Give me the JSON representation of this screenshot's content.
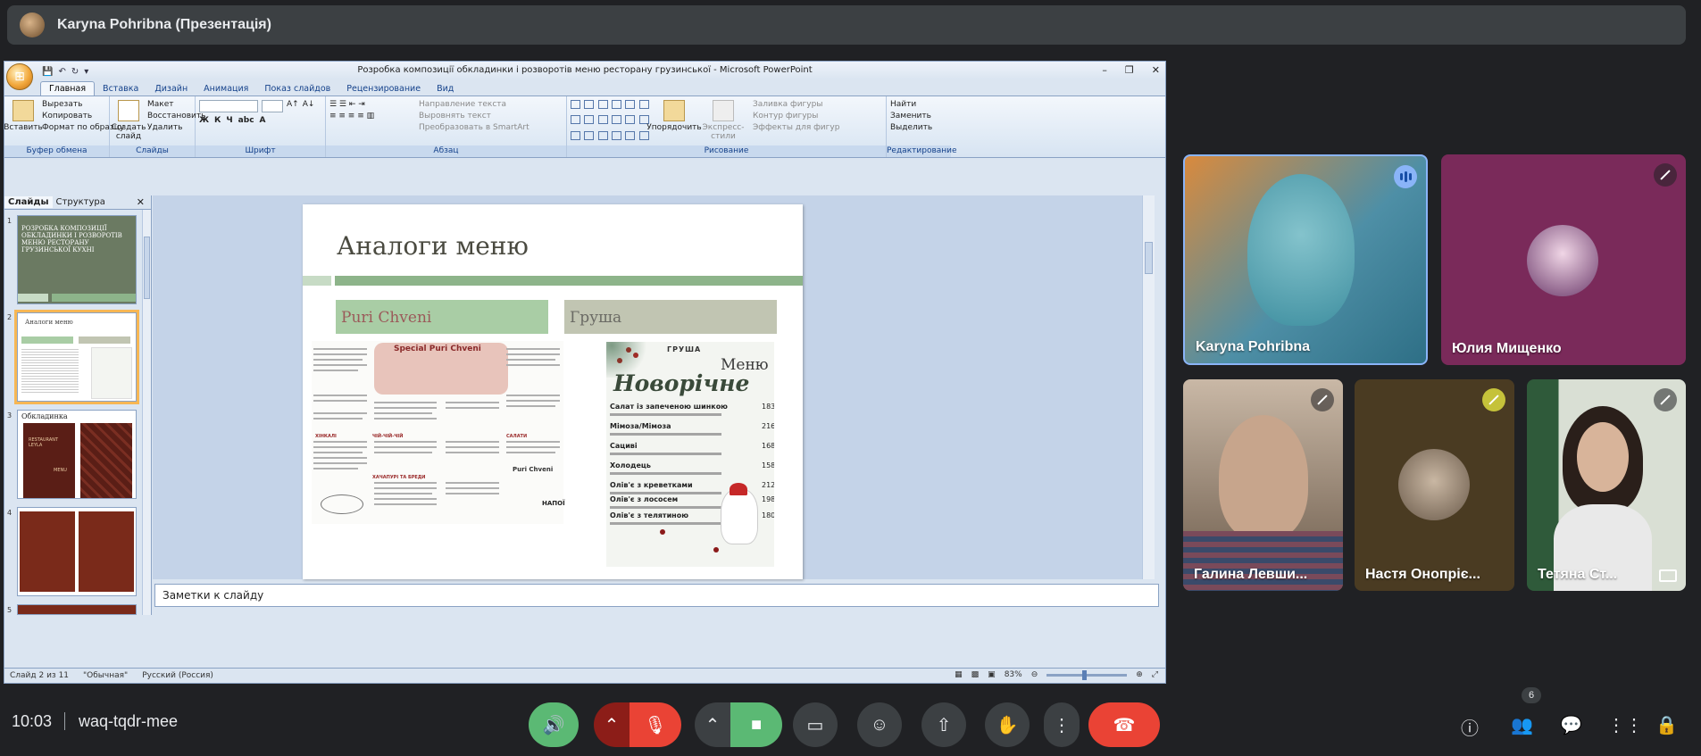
{
  "meet": {
    "presenter_title": "Karyna Pohribna (Презентація)",
    "time": "10:03",
    "meeting_code": "waq-tqdr-mee",
    "participants_count": "6",
    "accent_green": "#5bb974",
    "accent_red": "#ea4335"
  },
  "ppt": {
    "window_title": "Розробка композиції обкладинки і розворотів меню ресторану грузинської - Microsoft PowerPoint",
    "tabs": [
      "Главная",
      "Вставка",
      "Дизайн",
      "Анимация",
      "Показ слайдов",
      "Рецензирование",
      "Вид"
    ],
    "ribbon": {
      "paste_label": "Вставить",
      "cut": "Вырезать",
      "copy": "Копировать",
      "format_painter": "Формат по образцу",
      "clipboard_group": "Буфер обмена",
      "new_slide": "Создать слайд",
      "layout": "Макет",
      "reset": "Восстановить",
      "delete": "Удалить",
      "slides_group": "Слайды",
      "font_group": "Шрифт",
      "text_direction": "Направление текста",
      "align_text": "Выровнять текст",
      "convert_smartart": "Преобразовать в SmartArt",
      "paragraph_group": "Абзац",
      "arrange": "Упорядочить",
      "quick_styles": "Экспресс-стили",
      "shape_fill": "Заливка фигуры",
      "shape_outline": "Контур фигуры",
      "shape_effects": "Эффекты для фигур",
      "drawing_group": "Рисование",
      "find": "Найти",
      "replace": "Заменить",
      "select": "Выделить",
      "editing_group": "Редактирование"
    },
    "panel": {
      "tab_slides": "Слайды",
      "tab_outline": "Структура",
      "close": "✕",
      "slide1_title": "РОЗРОБКА КОМПОЗИЦІЇ ОБКЛАДИНКИ І РОЗВОРОТІВ МЕНЮ РЕСТОРАНУ ГРУЗИНСЬКОЇ КУХНІ",
      "slide2_title": "Аналоги меню",
      "slide3_title": "Обкладинка",
      "slide3_brand": "RESTAURANT LEYLA",
      "slide3_menu": "MENU",
      "nums": [
        "1",
        "2",
        "3",
        "4",
        "5"
      ]
    },
    "slide": {
      "title": "Аналоги меню",
      "label1": "Puri Chveni",
      "label2": "Груша",
      "menu1": {
        "special": "Special Puri Chveni",
        "headers": [
          "ХІНКАЛІ",
          "ЧІЙ-ЧІЙ-ЧІЙ",
          "ХАЧАПУРІ ТА БРЕДИ",
          "САЛАТИ"
        ],
        "brand": "Puri Chveni",
        "next": "НАПОЇ"
      },
      "menu2": {
        "brand": "ГРУША",
        "title": "Меню",
        "script": "Новорічне",
        "items": [
          {
            "name": "Салат із запеченою шинкою",
            "price": "183"
          },
          {
            "name": "Мімоза/Мімоза",
            "price": "216"
          },
          {
            "name": "Сациві",
            "price": "168"
          },
          {
            "name": "Холодець",
            "price": "158"
          },
          {
            "name": "Олів'є з креветками",
            "price": "212"
          },
          {
            "name": "Олів'є з лососем",
            "price": "198"
          },
          {
            "name": "Олів'є з телятиною",
            "price": "180"
          }
        ]
      }
    },
    "notes_placeholder": "Заметки к слайду",
    "status": {
      "slide_of": "Слайд 2 из 11",
      "theme": "\"Обычная\"",
      "language": "Русский (Россия)",
      "zoom": "83%"
    }
  },
  "tiles": [
    {
      "name": "Karyna Pohribna"
    },
    {
      "name": "Юлия Мищенко"
    },
    {
      "name": "Галина Левши..."
    },
    {
      "name": "Настя Онопріє..."
    },
    {
      "name": "Тетяна Ст..."
    }
  ]
}
